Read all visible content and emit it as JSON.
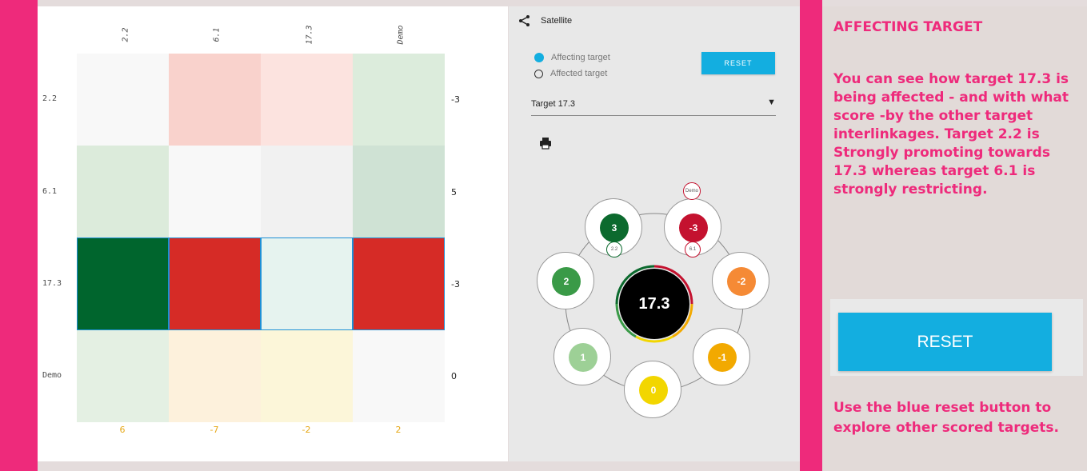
{
  "matrix": {
    "col_labels": [
      "2.2",
      "6.1",
      "17.3",
      "Demo"
    ],
    "row_labels": [
      "2.2",
      "6.1",
      "17.3",
      "Demo"
    ],
    "row_totals": [
      "-3",
      "5",
      "-3",
      "0"
    ],
    "col_totals": [
      "6",
      "-7",
      "-2",
      "2"
    ]
  },
  "satellite": {
    "title": "Satellite",
    "radio_affecting": "Affecting target",
    "radio_affected": "Affected target",
    "reset_label": "RESET",
    "select_value": "Target 17.3",
    "center_label": "17.3",
    "nodes": {
      "top_left": "3",
      "top_right": "-3",
      "left": "2",
      "right": "-2",
      "bottom_left": "1",
      "bottom_right": "-1",
      "bottom": "0"
    },
    "mini_labels": {
      "demo": "Demo",
      "t22": "2.2",
      "t61": "6.1"
    }
  },
  "info": {
    "heading": "AFFECTING TARGET",
    "body": "You can see how target 17.3 is being affected - and with what score -by the other target interlinkages. Target 2.2 is Strongly promoting towards 17.3 whereas target 6.1 is strongly restricting.",
    "reset_label": "RESET",
    "footer": "Use the blue reset button to explore other scored targets."
  },
  "colors": {
    "accent_pink": "#ee2a7b",
    "reset_blue": "#13aee0",
    "strong_red": "#d62b26",
    "strong_green": "#00682f"
  }
}
